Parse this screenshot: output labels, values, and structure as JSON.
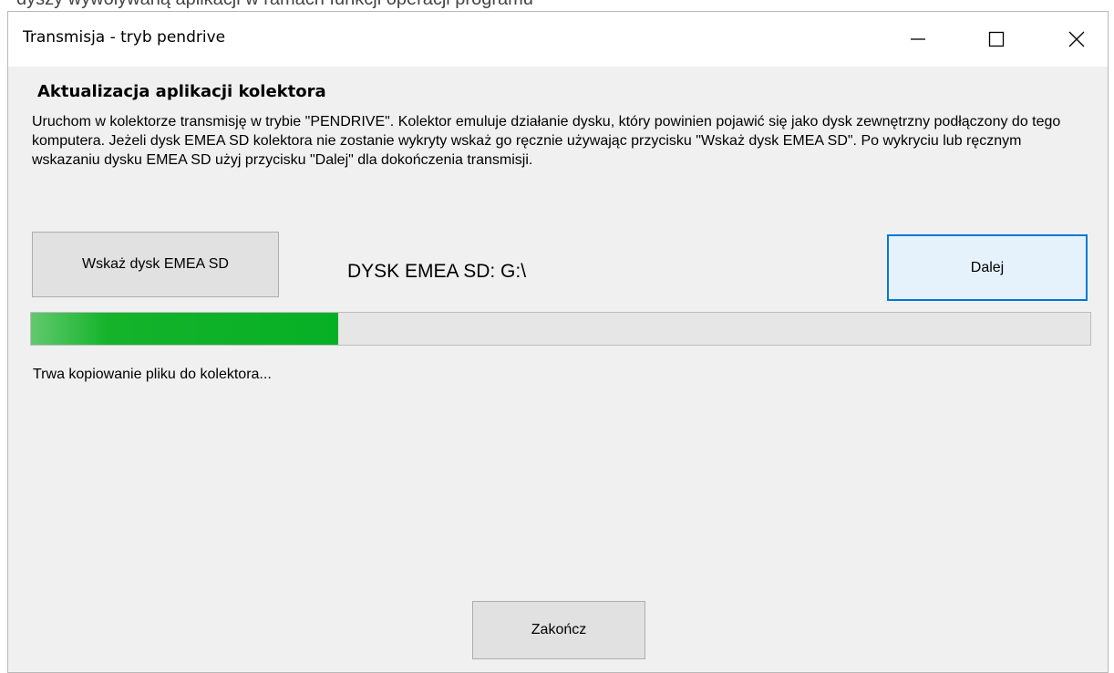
{
  "top_strip_text": "dyszy wywoływaną aplikacji w ramach funkcji operacji programu",
  "window": {
    "title": "Transmisja - tryb pendrive"
  },
  "heading": "Aktualizacja aplikacji kolektora",
  "description": "Uruchom w kolektorze transmisję w trybie \"PENDRIVE\". Kolektor emuluje działanie dysku, który powinien pojawić się jako dysk zewnętrzny podłączony do tego komputera.  Jeżeli dysk EMEA SD kolektora nie zostanie wykryty wskaż go ręcznie używając przycisku \"Wskaż dysk EMEA SD\". Po wykryciu lub ręcznym wskazaniu dysku EMEA SD użyj przycisku \"Dalej\" dla dokończenia transmisji.",
  "buttons": {
    "select_disk": "Wskaż dysk EMEA SD",
    "next": "Dalej",
    "finish": "Zakończ"
  },
  "disk_label": "DYSK EMEA SD:  G:\\",
  "progress": {
    "fraction": 0.29,
    "color": "#06b025"
  },
  "status_text": "Trwa kopiowanie pliku do kolektora...",
  "icons": [
    "minimize-icon",
    "maximize-icon",
    "close-icon"
  ]
}
